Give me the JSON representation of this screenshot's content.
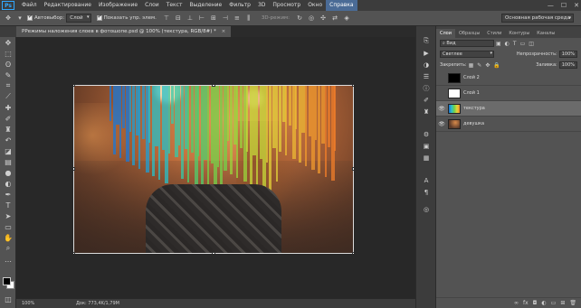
{
  "app": {
    "logo_text": "Ps"
  },
  "menu": [
    {
      "label": "Файл",
      "active": false
    },
    {
      "label": "Редактирование",
      "active": false
    },
    {
      "label": "Изображение",
      "active": false
    },
    {
      "label": "Слои",
      "active": false
    },
    {
      "label": "Текст",
      "active": false
    },
    {
      "label": "Выделение",
      "active": false
    },
    {
      "label": "Фильтр",
      "active": false
    },
    {
      "label": "3D",
      "active": false
    },
    {
      "label": "Просмотр",
      "active": false
    },
    {
      "label": "Окно",
      "active": false
    },
    {
      "label": "Справка",
      "active": true
    }
  ],
  "window_controls": {
    "minimize": "—",
    "maximize": "☐",
    "close": "✕"
  },
  "options": {
    "autoselect_label": "Автовыбор:",
    "autoselect_value": "Слой",
    "show_controls_label": "Показать упр. элем.",
    "mode_3d_label": "3D-режим:",
    "workspace": "Основная рабочая среда"
  },
  "document": {
    "tab_title": "РРежимы наложения слоев в фотошопе.psd @ 100% (текстура, RGB/8#) *",
    "close_glyph": "×",
    "zoom": "100%",
    "doc_info": "Док: 773,4K/1,79M"
  },
  "panel": {
    "tabs": [
      "Слои",
      "Образцы",
      "Стили",
      "Контуры",
      "Каналы"
    ],
    "active_tab": "Слои",
    "filter_label": "Вид",
    "blend_mode": "Светлее",
    "opacity_label": "Непрозрачность:",
    "opacity_value": "100%",
    "lock_label": "Закрепить:",
    "fill_label": "Заливка:",
    "fill_value": "100%",
    "layers": [
      {
        "name": "Слой 2",
        "visible": false,
        "selected": false,
        "thumb": "black"
      },
      {
        "name": "Слой 1",
        "visible": false,
        "selected": false,
        "thumb": "white"
      },
      {
        "name": "текстура",
        "visible": true,
        "selected": true,
        "thumb": "texture"
      },
      {
        "name": "девушка",
        "visible": true,
        "selected": false,
        "thumb": "photo"
      }
    ]
  },
  "colors": {
    "accent": "#4a6b96",
    "foreground": "#000000",
    "background": "#ffffff"
  }
}
